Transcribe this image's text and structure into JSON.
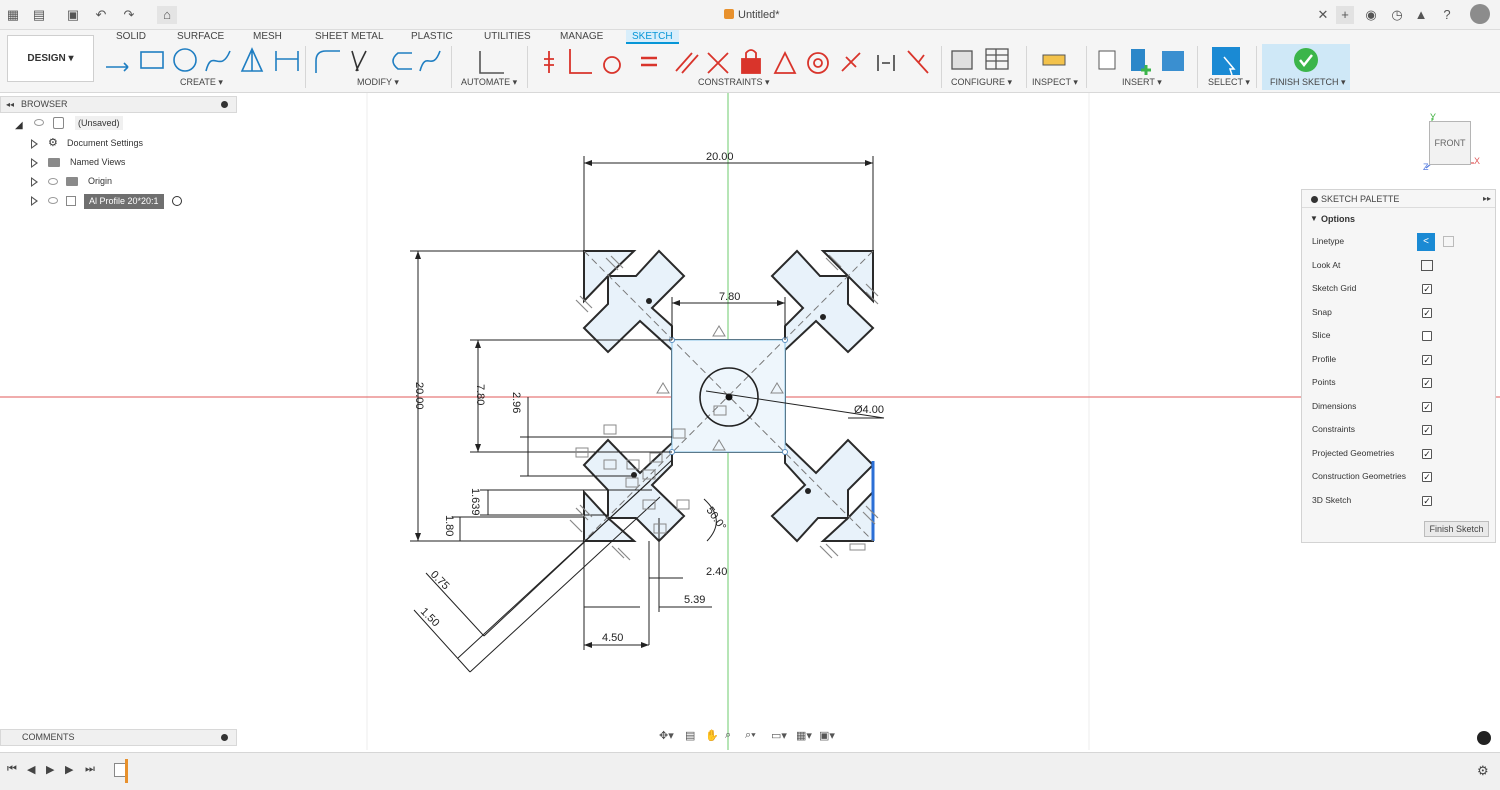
{
  "titlebar": {
    "document_title": "Untitled*"
  },
  "ribbon": {
    "workspace_label": "DESIGN",
    "tabs": [
      "SOLID",
      "SURFACE",
      "MESH",
      "SHEET METAL",
      "PLASTIC",
      "UTILITIES",
      "MANAGE",
      "SKETCH"
    ],
    "active_tab": "SKETCH",
    "groups": {
      "create": "CREATE",
      "modify": "MODIFY",
      "automate": "AUTOMATE",
      "constraints": "CONSTRAINTS",
      "configure": "CONFIGURE",
      "inspect": "INSPECT",
      "insert": "INSERT",
      "select": "SELECT",
      "finish": "FINISH SKETCH"
    }
  },
  "browser": {
    "title": "BROWSER",
    "root": "(Unsaved)",
    "items": [
      "Document Settings",
      "Named Views",
      "Origin",
      "Al Profile 20*20:1"
    ]
  },
  "sketch": {
    "dimensions": {
      "width_top": "20.00",
      "height_left": "20.00",
      "inner_width": "7.80",
      "inner_height": "7.80",
      "d_2_96": "2.96",
      "d_1_639": "1.639",
      "d_1_80": "1.80",
      "d_0_75": "0.75",
      "d_1_50": "1.50",
      "d_2_40": "2.40",
      "d_5_39": "5.39",
      "d_4_50": "4.50",
      "angle": "50.0°",
      "diameter": "Ø4.00"
    }
  },
  "palette": {
    "title": "SKETCH PALETTE",
    "section": "Options",
    "rows": [
      {
        "label": "Linetype"
      },
      {
        "label": "Look At"
      },
      {
        "label": "Sketch Grid",
        "checked": true
      },
      {
        "label": "Snap",
        "checked": true
      },
      {
        "label": "Slice",
        "checked": false
      },
      {
        "label": "Profile",
        "checked": true
      },
      {
        "label": "Points",
        "checked": true
      },
      {
        "label": "Dimensions",
        "checked": true
      },
      {
        "label": "Constraints",
        "checked": true
      },
      {
        "label": "Projected Geometries",
        "checked": true
      },
      {
        "label": "Construction Geometries",
        "checked": true
      },
      {
        "label": "3D Sketch",
        "checked": true
      }
    ],
    "finish_button": "Finish Sketch"
  },
  "viewcube": {
    "face": "FRONT",
    "axis_y": "Y",
    "axis_x": "X",
    "axis_z": "Z"
  },
  "comments": {
    "title": "COMMENTS"
  },
  "colors": {
    "accent": "#0696d7",
    "profile_fill": "#e8f2fa",
    "profile_stroke": "#2a2a2a",
    "axis_red": "#e05a5a",
    "axis_green": "#6ccb6c",
    "constraint_red": "#d9342b",
    "finish_green": "#3bb54a"
  }
}
